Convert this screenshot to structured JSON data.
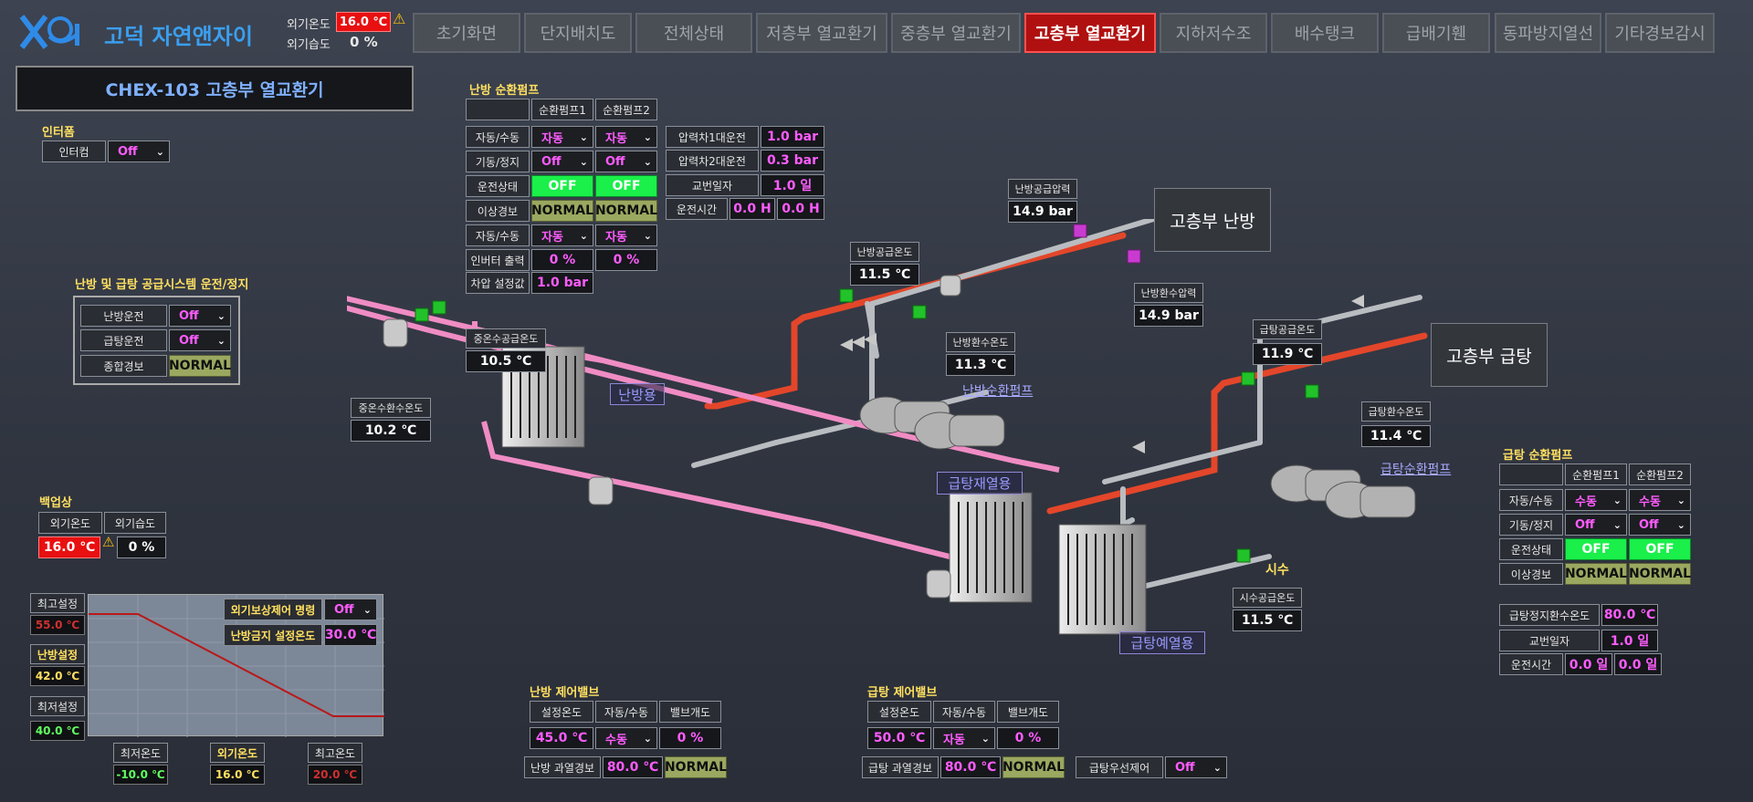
{
  "header": {
    "site_name": "고덕 자연앤자이",
    "outdoor_temp_label": "외기온도",
    "outdoor_temp_value": "16.0 ℃",
    "outdoor_humid_label": "외기습도",
    "outdoor_humid_value": "0 %"
  },
  "nav": [
    "초기화면",
    "단지배치도",
    "전체상태",
    "저층부 열교환기",
    "중층부 열교환기",
    "고층부 열교환기",
    "지하저수조",
    "배수탱크",
    "급배기휀",
    "동파방지열선",
    "기타경보감시"
  ],
  "nav_active": 5,
  "page_title": "CHEX-103 고층부 열교환기",
  "intercom": {
    "section": "인터폼",
    "label": "인터컴",
    "value": "Off"
  },
  "supply_system": {
    "section": "난방 및 급탕 공급시스템 운전/정지",
    "rows": [
      {
        "label": "난방운전",
        "value": "Off"
      },
      {
        "label": "급탕운전",
        "value": "Off"
      }
    ],
    "alarm_label": "종합경보",
    "alarm_value": "NORMAL"
  },
  "backup": {
    "section": "백업상",
    "temp_label": "외기온도",
    "humid_label": "외기습도",
    "temp_value": "16.0 ℃",
    "humid_value": "0 %"
  },
  "curve": {
    "max_set_label": "최고설정",
    "max_set_value": "55.0 ℃",
    "heat_set_label": "난방설정",
    "heat_set_value": "42.0 ℃",
    "min_set_label": "최저설정",
    "min_set_value": "40.0 ℃",
    "min_temp_label": "최저온도",
    "min_temp_value": "-10.0 ℃",
    "out_temp_label": "외기온도",
    "out_temp_value": "16.0 ℃",
    "max_temp_label": "최고온도",
    "max_temp_value": "20.0 ℃",
    "comp_cmd_label": "외기보상제어 명령",
    "comp_cmd_value": "Off",
    "stop_temp_label": "난방금지 설정온도",
    "stop_temp_value": "30.0 ℃"
  },
  "heat_pump": {
    "section": "난방 순환펌프",
    "col1": "순환펌프1",
    "col2": "순환펌프2",
    "rows": [
      {
        "label": "자동/수동",
        "type": "sel",
        "v1": "자동",
        "v2": "자동"
      },
      {
        "label": "기동/정지",
        "type": "sel",
        "v1": "Off",
        "v2": "Off"
      },
      {
        "label": "운전상태",
        "type": "green",
        "v1": "OFF",
        "v2": "OFF"
      },
      {
        "label": "이상경보",
        "type": "normal",
        "v1": "NORMAL",
        "v2": "NORMAL"
      },
      {
        "label": "자동/수동",
        "type": "sel",
        "v1": "자동",
        "v2": "자동"
      },
      {
        "label": "인버터 출력",
        "type": "val",
        "v1": "0 %",
        "v2": "0 %"
      }
    ],
    "diff_label": "차압 설정값",
    "diff_value": "1.0 bar",
    "p1_label": "압력차1대운전",
    "p1_value": "1.0 bar",
    "p2_label": "압력차2대운전",
    "p2_value": "0.3 bar",
    "swap_label": "교번일자",
    "swap_value": "1.0 일",
    "run_label": "운전시간",
    "run_v1": "0.0 H",
    "run_v2": "0.0 H"
  },
  "diagram": {
    "heat_supply_pressure_label": "난방공급압력",
    "heat_supply_pressure_value": "14.9 bar",
    "high_heat_box": "고층부 난방",
    "heat_supply_temp_label": "난방공급온도",
    "heat_supply_temp_value": "11.5 ℃",
    "heat_return_pressure_label": "난방환수압력",
    "heat_return_pressure_value": "14.9 bar",
    "mid_supply_label": "중온수공급온도",
    "mid_supply_value": "10.5 ℃",
    "heat_return_temp_label": "난방환수온도",
    "heat_return_temp_value": "11.3 ℃",
    "heat_pump_tag": "난방순환펌프",
    "mid_return_label": "중온수환수온도",
    "mid_return_value": "10.2 ℃",
    "heat_hx_tag": "난방용",
    "hw_supply_temp_label": "급탕공급온도",
    "hw_supply_temp_value": "11.9 ℃",
    "high_hw_box": "고층부 급탕",
    "hw_return_temp_label": "급탕환수온도",
    "hw_return_temp_value": "11.4 ℃",
    "hw_pump_tag": "급탕순환펌프",
    "hw_reheat_tag": "급탕재열용",
    "city_water_tag": "시수",
    "city_water_temp_label": "시수공급온도",
    "city_water_temp_value": "11.5 ℃",
    "hw_preheat_tag": "급탕예열용"
  },
  "heat_valve": {
    "section": "난방 제어밸브",
    "h1": "설정온도",
    "h2": "자동/수동",
    "h3": "밸브개도",
    "v1": "45.0 ℃",
    "v2": "수동",
    "v3": "0 %",
    "over_label": "난방 과열경보",
    "over_value": "80.0 ℃",
    "over_status": "NORMAL"
  },
  "hw_valve": {
    "section": "급탕 제어밸브",
    "h1": "설정온도",
    "h2": "자동/수동",
    "h3": "밸브개도",
    "v1": "50.0 ℃",
    "v2": "자동",
    "v3": "0 %",
    "over_label": "급탕 과열경보",
    "over_value": "80.0 ℃",
    "over_status": "NORMAL",
    "priority_label": "급탕우선제어",
    "priority_value": "Off"
  },
  "hw_pump": {
    "section": "급탕 순환펌프",
    "col1": "순환펌프1",
    "col2": "순환펌프2",
    "rows": [
      {
        "label": "자동/수동",
        "type": "sel",
        "v1": "수동",
        "v2": "수동"
      },
      {
        "label": "기동/정지",
        "type": "sel",
        "v1": "Off",
        "v2": "Off"
      },
      {
        "label": "운전상태",
        "type": "green",
        "v1": "OFF",
        "v2": "OFF"
      },
      {
        "label": "이상경보",
        "type": "normal",
        "v1": "NORMAL",
        "v2": "NORMAL"
      }
    ],
    "stop_temp_label": "급탕정지환수온도",
    "stop_temp_value": "80.0 ℃",
    "swap_label": "교번일자",
    "swap_value": "1.0 일",
    "run_label": "운전시간",
    "run_v1": "0.0 일",
    "run_v2": "0.0 일"
  }
}
